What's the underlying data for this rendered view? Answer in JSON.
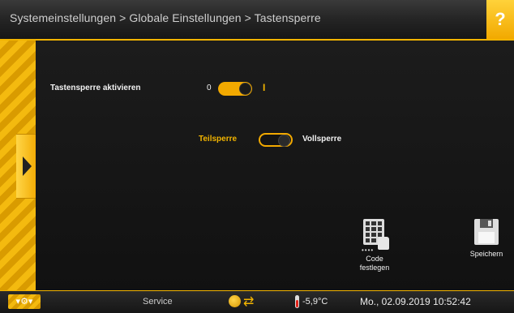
{
  "header": {
    "breadcrumb": "Systemeinstellungen > Globale Einstellungen > Tastensperre",
    "help_label": "?"
  },
  "settings": {
    "lock_label": "Tastensperre aktivieren",
    "lock_off": "0",
    "lock_on": "I",
    "lock_enabled": true,
    "mode_left": "Teilsperre",
    "mode_right": "Vollsperre",
    "mode_selected": "Teilsperre"
  },
  "actions": {
    "code_line1": "Code",
    "code_line2": "festlegen",
    "save": "Speichern"
  },
  "statusbar": {
    "service": "Service",
    "temperature": "-5,9°C",
    "datetime": "Mo., 02.09.2019 10:52:42"
  },
  "icons": {
    "help": "question-icon",
    "side": "chevron-right-icon",
    "keypad": "keypad-icon",
    "save": "floppy-disk-icon",
    "tools": "gear-icon",
    "globe": "globe-icon",
    "arrows": "swap-arrows-icon",
    "thermo": "thermometer-icon"
  },
  "colors": {
    "accent": "#f2b400",
    "background": "#111111",
    "text": "#f2f2f2"
  }
}
